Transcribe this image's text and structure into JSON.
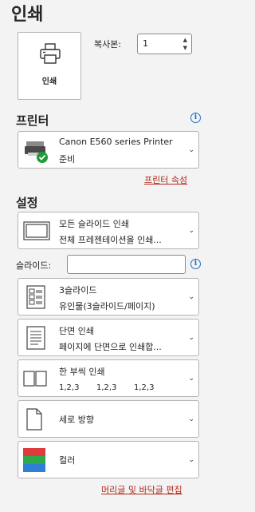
{
  "header": {
    "title": "인쇄"
  },
  "print_button": {
    "label": "인쇄"
  },
  "copies": {
    "label": "복사본:",
    "value": "1"
  },
  "printer": {
    "heading": "프린터",
    "name": "Canon E560 series Printer",
    "status": "준비",
    "properties_link": "프린터 속성"
  },
  "settings": {
    "heading": "설정",
    "range": {
      "line1": "모든 슬라이드 인쇄",
      "line2": "전체 프레젠테이션을 인쇄..."
    },
    "slides_label": "슬라이드:",
    "slides_value": "",
    "layout": {
      "line1": "3슬라이드",
      "line2": "유인물(3슬라이드/페이지)"
    },
    "sides": {
      "line1": "단면 인쇄",
      "line2": "페이지에 단면으로 인쇄합..."
    },
    "collate": {
      "line1": "한 부씩 인쇄",
      "seq1": "1,2,3",
      "seq2": "1,2,3",
      "seq3": "1,2,3"
    },
    "orientation": {
      "line1": "세로 방향"
    },
    "color": {
      "line1": "컬러"
    },
    "header_footer_link": "머리글 및 바닥글 편집"
  },
  "icons": {
    "printer": "printer-icon",
    "ready": "check-circle-icon",
    "info": "info-icon",
    "chevron": "chevron-down-icon"
  }
}
